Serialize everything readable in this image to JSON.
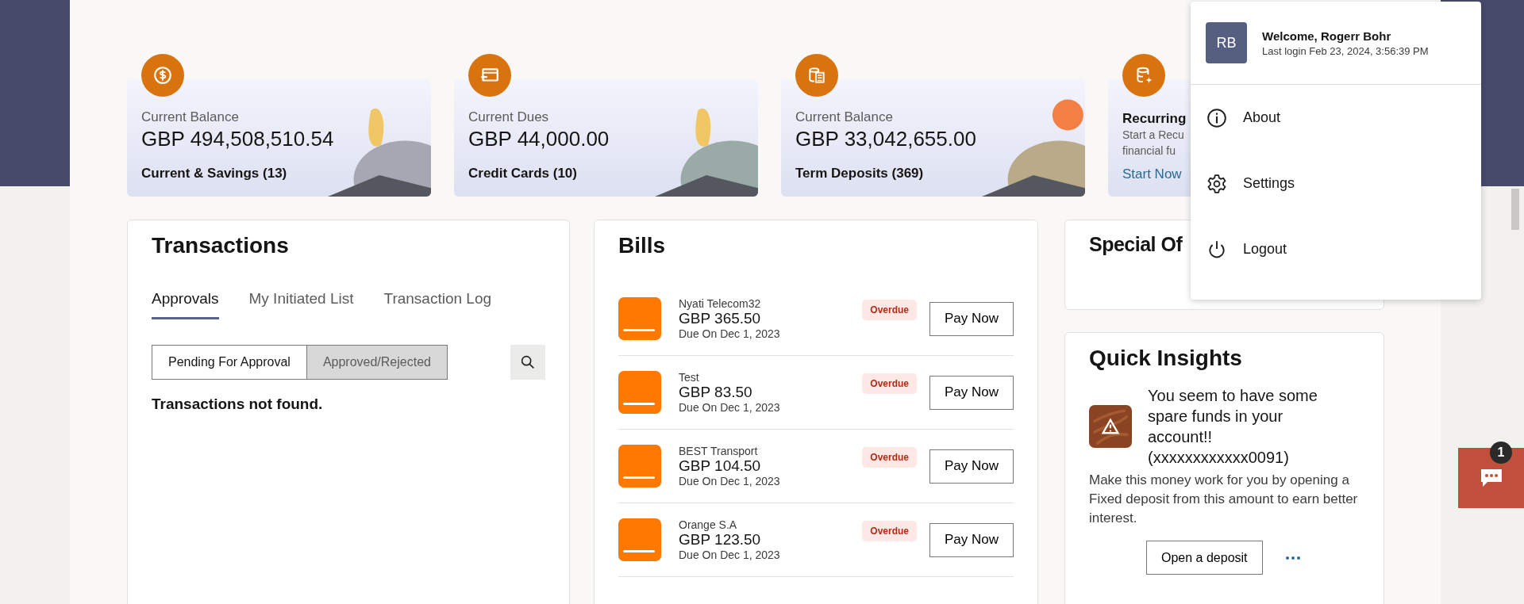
{
  "summary_cards": [
    {
      "kind": "balance",
      "label": "Current Balance",
      "amount": "GBP 494,508,510.54",
      "footer": "Current & Savings (13)"
    },
    {
      "kind": "dues",
      "label": "Current Dues",
      "amount": "GBP 44,000.00",
      "footer": "Credit Cards (10)"
    },
    {
      "kind": "deposits",
      "label": "Current Balance",
      "amount": "GBP 33,042,655.00",
      "footer": "Term Deposits (369)"
    },
    {
      "kind": "promo",
      "title": "Recurring",
      "lines": [
        "Start a Recu",
        "financial fu"
      ],
      "link": "Start Now"
    }
  ],
  "transactions": {
    "title": "Transactions",
    "tabs": [
      {
        "label": "Approvals",
        "selected": true
      },
      {
        "label": "My Initiated List",
        "selected": false
      },
      {
        "label": "Transaction Log",
        "selected": false
      }
    ],
    "filters": [
      {
        "label": "Pending For Approval",
        "selected": true
      },
      {
        "label": "Approved/Rejected",
        "selected": false
      }
    ],
    "message": "Transactions not found."
  },
  "bills": {
    "title": "Bills",
    "items": [
      {
        "name": "Nyati Telecom32",
        "amount": "GBP 365.50",
        "due": "Due On Dec 1, 2023",
        "status": "Overdue",
        "action": "Pay Now"
      },
      {
        "name": "Test",
        "amount": "GBP 83.50",
        "due": "Due On Dec 1, 2023",
        "status": "Overdue",
        "action": "Pay Now"
      },
      {
        "name": "BEST Transport",
        "amount": "GBP 104.50",
        "due": "Due On Dec 1, 2023",
        "status": "Overdue",
        "action": "Pay Now"
      },
      {
        "name": "Orange S.A",
        "amount": "GBP 123.50",
        "due": "Due On Dec 1, 2023",
        "status": "Overdue",
        "action": "Pay Now"
      }
    ]
  },
  "special_offers": {
    "title": "Special Of"
  },
  "quick_insights": {
    "title": "Quick Insights",
    "headline": "You seem to have some spare funds in your account!! (xxxxxxxxxxxx0091)",
    "body": "Make this money work for you by opening a Fixed deposit from this amount to earn better interest.",
    "button": "Open a deposit"
  },
  "user_menu": {
    "initials": "RB",
    "welcome": "Welcome, Rogerr Bohr",
    "last_login": "Last login Feb 23, 2024, 3:56:39 PM",
    "items": [
      {
        "kind": "about",
        "label": "About"
      },
      {
        "kind": "settings",
        "label": "Settings"
      },
      {
        "kind": "logout",
        "label": "Logout"
      }
    ]
  },
  "chat": {
    "badge": "1"
  }
}
